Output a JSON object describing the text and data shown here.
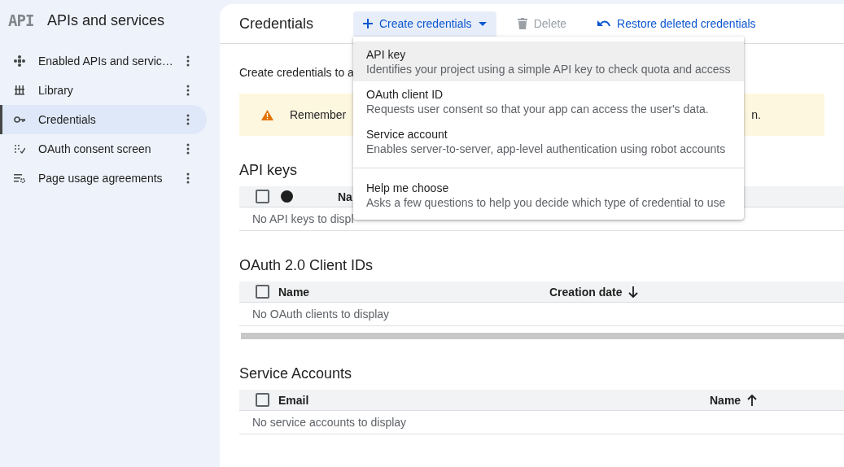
{
  "sidebar": {
    "logo": "API",
    "title": "APIs and services",
    "items": [
      {
        "label": "Enabled APIs and servic…",
        "kind": "diamond",
        "selected": false
      },
      {
        "label": "Library",
        "kind": "library",
        "selected": false
      },
      {
        "label": "Credentials",
        "kind": "key",
        "selected": true
      },
      {
        "label": "OAuth consent screen",
        "kind": "dots",
        "selected": false
      },
      {
        "label": "Page usage agreements",
        "kind": "list-gear",
        "selected": false
      }
    ]
  },
  "toolbar": {
    "title": "Credentials",
    "actions": [
      {
        "label": "Create credentials",
        "kind": "create",
        "disabled": false,
        "expanded": true
      },
      {
        "label": "Delete",
        "kind": "delete",
        "disabled": true,
        "expanded": false
      },
      {
        "label": "Restore deleted credentials",
        "kind": "restore",
        "disabled": false,
        "expanded": false
      }
    ]
  },
  "menu": {
    "items": [
      {
        "title": "API key",
        "description": "Identifies your project using a simple API key to check quota and access",
        "highlighted": true,
        "separator_before": false
      },
      {
        "title": "OAuth client ID",
        "description": "Requests user consent so that your app can access the user's data.",
        "highlighted": false,
        "separator_before": false
      },
      {
        "title": "Service account",
        "description": "Enables server-to-server, app-level authentication using robot accounts",
        "highlighted": false,
        "separator_before": false
      },
      {
        "title": "Help me choose",
        "description": "Asks a few questions to help you decide which type of credential to use",
        "highlighted": false,
        "separator_before": true
      }
    ]
  },
  "intro": "Create credentials to a",
  "banner": {
    "text": "Remember",
    "tail": "n."
  },
  "sections": [
    {
      "title": "API keys",
      "kind": "api-keys",
      "select_all_checked": false,
      "columns": [
        {
          "label": "Na"
        }
      ],
      "empty_text": "No API keys to displ",
      "horizontal_scrollbar": false
    },
    {
      "title": "OAuth 2.0 Client IDs",
      "kind": "oauth",
      "select_all_checked": false,
      "columns": [
        {
          "label": "Name"
        },
        {
          "label": "Creation date",
          "sort_ascending": false
        }
      ],
      "empty_text": "No OAuth clients to display",
      "horizontal_scrollbar": true
    },
    {
      "title": "Service Accounts",
      "kind": "service-accounts",
      "select_all_checked": false,
      "columns": [
        {
          "label": "Email"
        },
        {
          "label": "Name",
          "sort_ascending": true
        }
      ],
      "empty_text": "No service accounts to display",
      "horizontal_scrollbar": false
    }
  ]
}
